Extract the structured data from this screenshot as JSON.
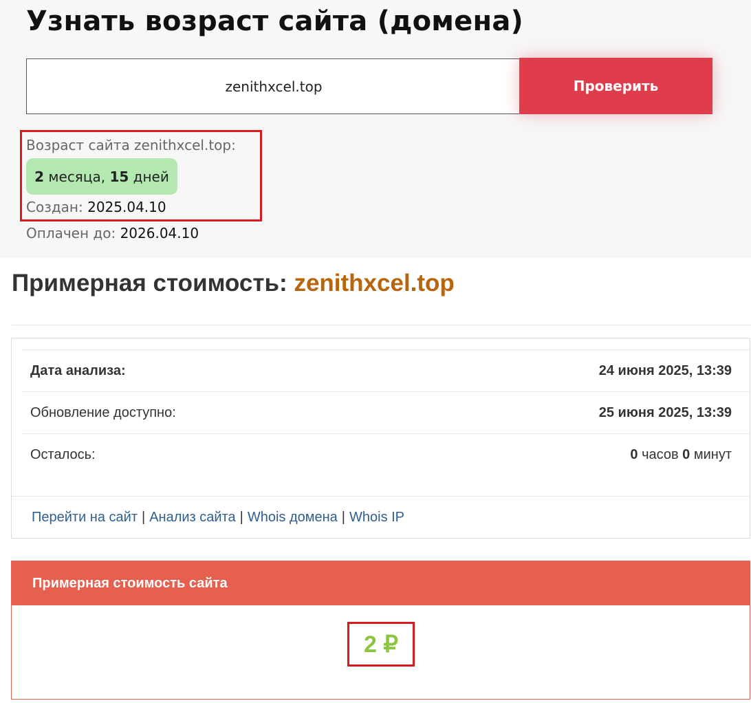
{
  "age_checker": {
    "title": "Узнать возраст сайта (домена)",
    "domain_value": "zenithxcel.top",
    "check_button": "Проверить",
    "age_label": "Возраст сайта zenithxcel.top:",
    "age_months": "2",
    "age_months_word": "месяца,",
    "age_days": "15",
    "age_days_word": "дней",
    "created_label": "Создан:",
    "created_value": "2025.04.10",
    "paid_label": "Оплачен до:",
    "paid_value": "2026.04.10"
  },
  "cost": {
    "title_prefix": "Примерная стоимость:",
    "title_domain": "zenithxcel.top",
    "rows": [
      {
        "label": "Дата анализа:",
        "value": "24 июня 2025, 13:39"
      },
      {
        "label": "Обновление доступно:",
        "value": "25 июня 2025, 13:39"
      }
    ],
    "remaining": {
      "label": "Осталось:",
      "hours": "0",
      "hours_word": "часов",
      "minutes": "0",
      "minutes_word": "минут"
    },
    "links": {
      "go_to_site": "Перейти на сайт",
      "site_analysis": "Анализ сайта",
      "whois_domain": "Whois домена",
      "whois_ip": "Whois IP",
      "separator": "|"
    },
    "estimate": {
      "header": "Примерная стоимость сайта",
      "value": "2 ₽"
    }
  },
  "colors": {
    "button": "#e03d4c",
    "badge": "#b3e8b0",
    "highlight_border": "#d71920",
    "domain_accent": "#b8650b",
    "estimate_header": "#e5604f",
    "estimate_value": "#8cc63f",
    "link": "#2f5f8f"
  }
}
